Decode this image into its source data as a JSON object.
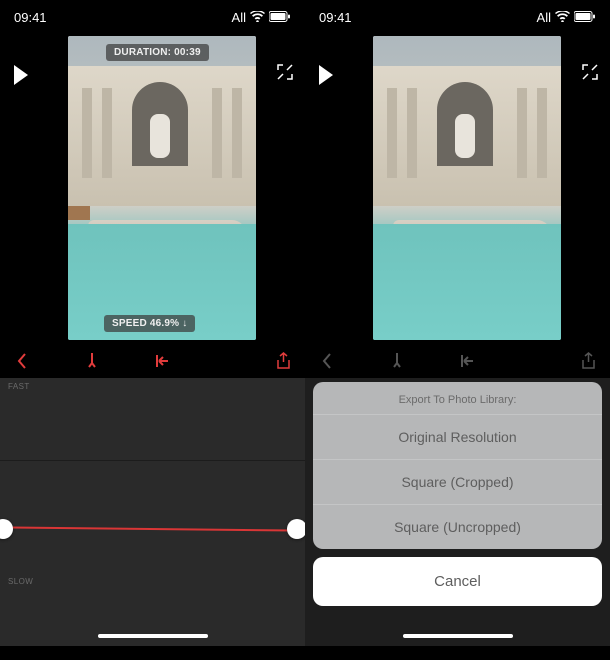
{
  "status": {
    "time": "09:41",
    "carrier": "All"
  },
  "left": {
    "duration_badge": "DURATION: 00:39",
    "speed_badge": "SPEED 46.9% ↓",
    "labels": {
      "fast": "FAST",
      "slow": "SLOW"
    }
  },
  "right": {
    "sheet": {
      "title": "Export To Photo Library:",
      "options": [
        "Original Resolution",
        "Square (Cropped)",
        "Square (Uncropped)"
      ],
      "cancel": "Cancel"
    }
  }
}
